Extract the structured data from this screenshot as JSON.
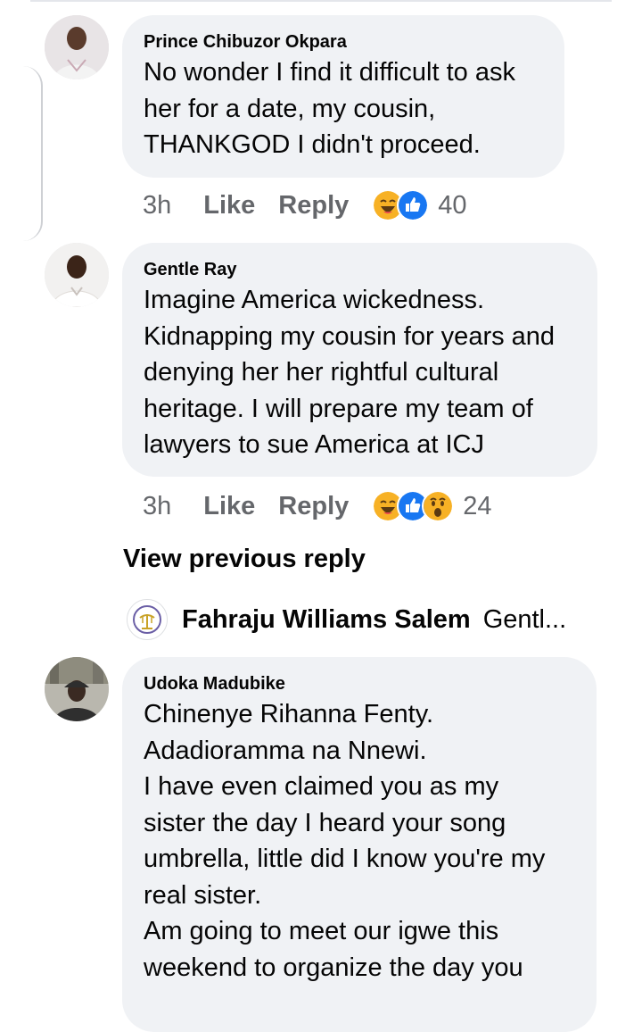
{
  "comments": [
    {
      "author": "Prince Chibuzor Okpara",
      "lines": [
        "No wonder I find it difficult to ask",
        "her for a date, my cousin,",
        "THANKGOD I didn't proceed."
      ],
      "time": "3h",
      "like_label": "Like",
      "reply_label": "Reply",
      "reactions": [
        "haha-icon",
        "like-icon"
      ],
      "reaction_count": "40"
    },
    {
      "author": "Gentle Ray",
      "lines": [
        "Imagine America wickedness.",
        "Kidnapping my cousin for years and",
        "denying her her rightful cultural",
        "heritage. I will prepare my team of",
        "lawyers to sue America at ICJ"
      ],
      "time": "3h",
      "like_label": "Like",
      "reply_label": "Reply",
      "reactions": [
        "haha-icon",
        "like-icon",
        "wow-icon"
      ],
      "reaction_count": "24"
    },
    {
      "author": "Udoka Madubike",
      "lines": [
        "Chinenye Rihanna Fenty.",
        "Adadioramma na Nnewi.",
        "I have even claimed you as my",
        "sister the day I heard your song",
        "umbrella, little did I know you're my",
        "real sister.",
        "Am going to meet our igwe this",
        "weekend to organize the day you"
      ]
    }
  ],
  "view_previous_reply": "View previous reply",
  "collapsed_reply": {
    "author": "Fahraju Williams Salem",
    "snippet": "Gentl..."
  },
  "colors": {
    "bubble": "#f0f2f5",
    "secondary_text": "#65676b",
    "like_blue": "#1877f2",
    "haha_yellow": "#f7b125"
  }
}
